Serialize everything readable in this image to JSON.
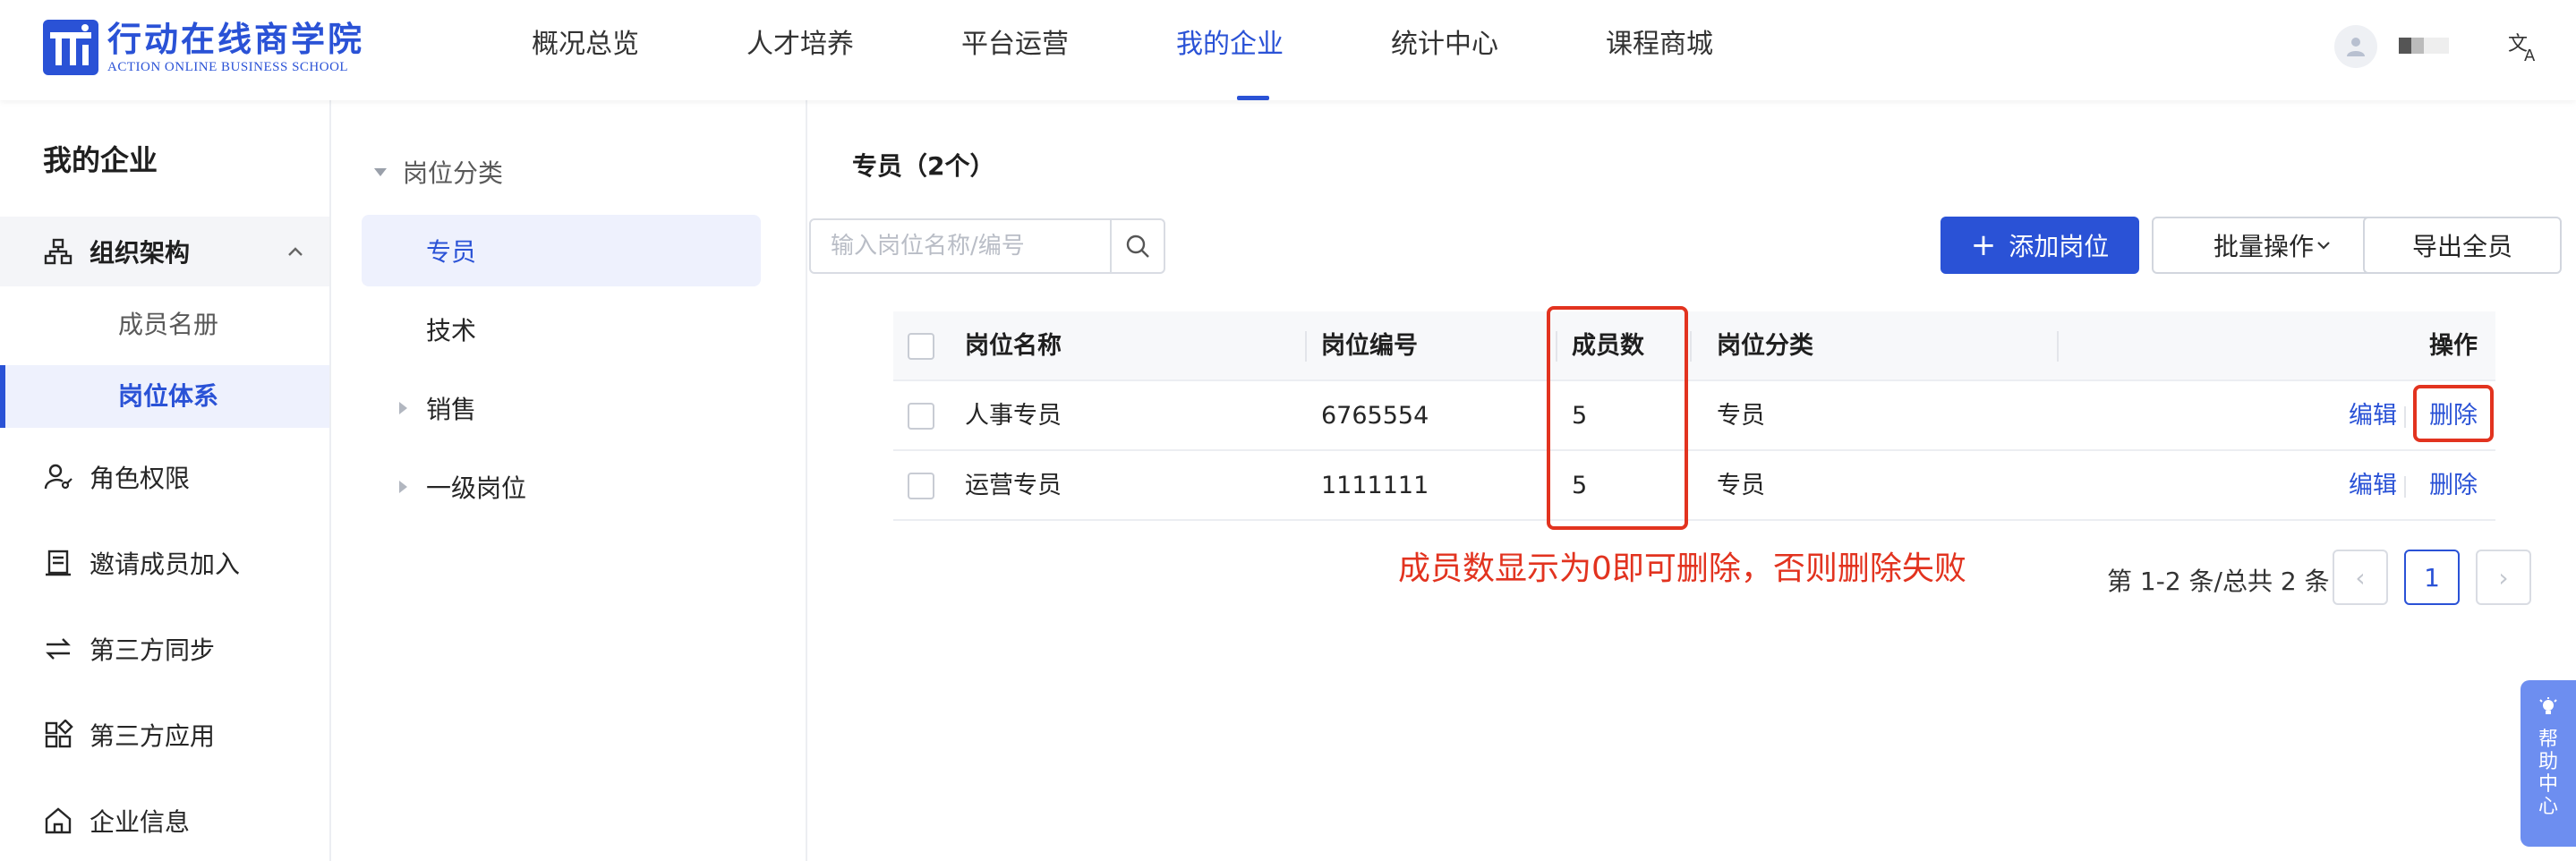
{
  "header": {
    "logo_cn": "行动在线商学院",
    "logo_en": "ACTION ONLINE BUSINESS SCHOOL",
    "nav": [
      {
        "label": "概况总览",
        "active": false
      },
      {
        "label": "人才培养",
        "active": false
      },
      {
        "label": "平台运营",
        "active": false
      },
      {
        "label": "我的企业",
        "active": true
      },
      {
        "label": "统计中心",
        "active": false
      },
      {
        "label": "课程商城",
        "active": false
      }
    ],
    "brand_color": "#2a52d6"
  },
  "sidebar": {
    "title": "我的企业",
    "group": {
      "label": "组织架构",
      "icon": "org-chart-icon",
      "expanded": true
    },
    "sub_items": [
      {
        "label": "成员名册",
        "active": false
      },
      {
        "label": "岗位体系",
        "active": true
      }
    ],
    "items": [
      {
        "label": "角色权限",
        "icon": "user-key-icon"
      },
      {
        "label": "邀请成员加入",
        "icon": "document-icon"
      },
      {
        "label": "第三方同步",
        "icon": "swap-icon"
      },
      {
        "label": "第三方应用",
        "icon": "apps-icon"
      },
      {
        "label": "企业信息",
        "icon": "home-icon"
      }
    ]
  },
  "tree": {
    "root": "岗位分类",
    "nodes": [
      {
        "label": "专员",
        "active": true,
        "has_children": false
      },
      {
        "label": "技术",
        "active": false,
        "has_children": false
      },
      {
        "label": "销售",
        "active": false,
        "has_children": true
      },
      {
        "label": "一级岗位",
        "active": false,
        "has_children": true
      }
    ]
  },
  "main": {
    "title": "专员（2个）",
    "search": {
      "placeholder": "输入岗位名称/编号",
      "value": ""
    },
    "buttons": {
      "add": "添加岗位",
      "batch": "批量操作",
      "export": "导出全员"
    },
    "table": {
      "columns": [
        "岗位名称",
        "岗位编号",
        "成员数",
        "岗位分类",
        "操作"
      ],
      "rows": [
        {
          "name": "人事专员",
          "code": "6765554",
          "members": "5",
          "category": "专员",
          "edit": "编辑",
          "delete": "删除"
        },
        {
          "name": "运营专员",
          "code": "1111111",
          "members": "5",
          "category": "专员",
          "edit": "编辑",
          "delete": "删除"
        }
      ]
    },
    "annotation": "成员数显示为0即可删除，否则删除失败",
    "annotation_color": "#e2331f",
    "pagination": {
      "total": "第 1-2 条/总共 2 条",
      "current": "1",
      "prev": "‹",
      "next": "›"
    }
  },
  "help": {
    "label": "帮助中心"
  }
}
